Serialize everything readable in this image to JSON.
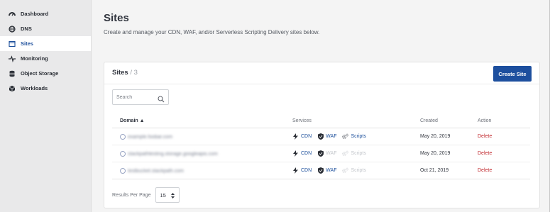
{
  "sidebar": {
    "items": [
      {
        "label": "Dashboard"
      },
      {
        "label": "DNS"
      },
      {
        "label": "Sites"
      },
      {
        "label": "Monitoring"
      },
      {
        "label": "Object Storage"
      },
      {
        "label": "Workloads"
      }
    ]
  },
  "page": {
    "title": "Sites",
    "subtitle": "Create and manage your CDN, WAF, and/or Serverless Scripting Delivery sites below."
  },
  "card": {
    "title": "Sites",
    "count": "/ 3",
    "create_label": "Create Site"
  },
  "search": {
    "placeholder": "Search"
  },
  "table": {
    "headers": {
      "domain": "Domain ▲",
      "services": "Services",
      "created": "Created",
      "action": "Action"
    },
    "rows": [
      {
        "domain": "example.foobar.com",
        "cdn": "CDN",
        "waf": "WAF",
        "scripts": "Scripts",
        "created": "May 20, 2019",
        "action": "Delete"
      },
      {
        "domain": "stackpathtesting.storage.googleapis.com",
        "cdn": "CDN",
        "waf": "WAF",
        "scripts": "Scripts",
        "created": "May 20, 2019",
        "action": "Delete"
      },
      {
        "domain": "testbucket.stackpath.com",
        "cdn": "CDN",
        "waf": "WAF",
        "scripts": "Scripts",
        "created": "Oct 21, 2019",
        "action": "Delete"
      }
    ]
  },
  "pager": {
    "label": "Results Per Page",
    "value": "15"
  },
  "colors": {
    "accent": "#1d4f9e",
    "danger": "#c0262b",
    "muted": "#c3c6cb"
  }
}
